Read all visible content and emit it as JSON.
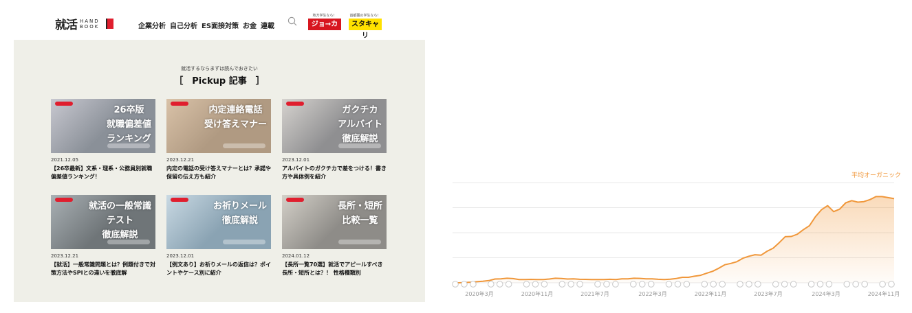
{
  "site": {
    "logo": {
      "kanji": "就活",
      "small": "HAND BOOK"
    },
    "nav": [
      "企業分析",
      "自己分析",
      "ES面接対策",
      "お金",
      "連載"
    ],
    "banners": [
      {
        "tag": "地方学生なら！",
        "label": "ジョ→カツ"
      },
      {
        "tag": "首都圏の学生なら！",
        "label": "スタキャリ"
      }
    ],
    "subtitle": "就活するならまずは読んでおきたい",
    "section_title": "［　Pickup 記事　］",
    "cards": [
      {
        "thumb_text": "26卒版\n就職偏差値\nランキング",
        "date": "2021.12.05",
        "title": "【26卒最新】文系・理系・公務員別就職偏差値ランキング！",
        "bg": "#8a9098",
        "accent": "#c8c8d0"
      },
      {
        "thumb_text": "内定連絡電話\n受け答えマナー",
        "date": "2023.12.21",
        "title": "内定の電話の受け答えマナーとは？承諾や保留の伝え方も紹介",
        "bg": "#b09a82",
        "accent": "#d9c2a8"
      },
      {
        "thumb_text": "ガクチカ\nアルバイト\n徹底解説",
        "date": "2023.12.01",
        "title": "アルバイトのガクチカで差をつける！書き方や具体例を紹介",
        "bg": "#8f8f91",
        "accent": "#d6d3cf"
      },
      {
        "thumb_text": "就活の一般常識\nテスト\n徹底解説",
        "date": "2023.12.21",
        "title": "【就活】一般常識問題とは？例題付きで対策方法やSPIとの違いを徹底解",
        "bg": "#6f7578",
        "accent": "#a9b0b4"
      },
      {
        "thumb_text": "お祈りメール\n徹底解説",
        "date": "2023.12.01",
        "title": "【例文あり】お祈りメールの返信は？ポイントやケース別に紹介",
        "bg": "#8aa3b3",
        "accent": "#c9d9e3"
      },
      {
        "thumb_text": "長所・短所\n比較一覧",
        "date": "2024.01.12",
        "title": "【長所一覧70選】就活でアピールすべき長所・短所とは？！ 性格種類別",
        "bg": "#8e8c88",
        "accent": "#d4d0c8"
      }
    ],
    "colors": {
      "brand_red": "#e01e2e",
      "jokatsu_red": "#d7161f",
      "stacari_yellow": "#ffe100",
      "body_bg": "#efefe8"
    }
  },
  "chart_data": {
    "type": "area",
    "series": [
      {
        "name": "平均オーガニック",
        "color": "#f0973a",
        "values": [
          0,
          0,
          0.3,
          0.6,
          1.1,
          1.6,
          2.2,
          3.8,
          4,
          4.5,
          4.2,
          3.2,
          3.2,
          3.4,
          3.2,
          3.2,
          3.8,
          4.5,
          4.3,
          3.8,
          3.9,
          3.5,
          3.4,
          3.3,
          3.2,
          3.2,
          3.5,
          3.3,
          4,
          4,
          4.5,
          4.4,
          3.9,
          3.9,
          3.5,
          3.2,
          3.6,
          4.3,
          5.5,
          5.5,
          6.6,
          7.5,
          9.5,
          11.5,
          14.5,
          18,
          19.3,
          21,
          24.5,
          26.5,
          28,
          27.5,
          31.5,
          34.5,
          40,
          46,
          46.2,
          48.5,
          53,
          57,
          66,
          73,
          77,
          71,
          73.5,
          79.8,
          82,
          80.5,
          81,
          83,
          86,
          86,
          85,
          84
        ]
      }
    ],
    "x_tick_labels": [
      "2020年3月",
      "2020年11月",
      "2021年7月",
      "2022年3月",
      "2022年11月",
      "2023年7月",
      "2024年3月",
      "2024年11月"
    ],
    "ylim": [
      0,
      100
    ],
    "grid": true,
    "legend": "top-right"
  }
}
